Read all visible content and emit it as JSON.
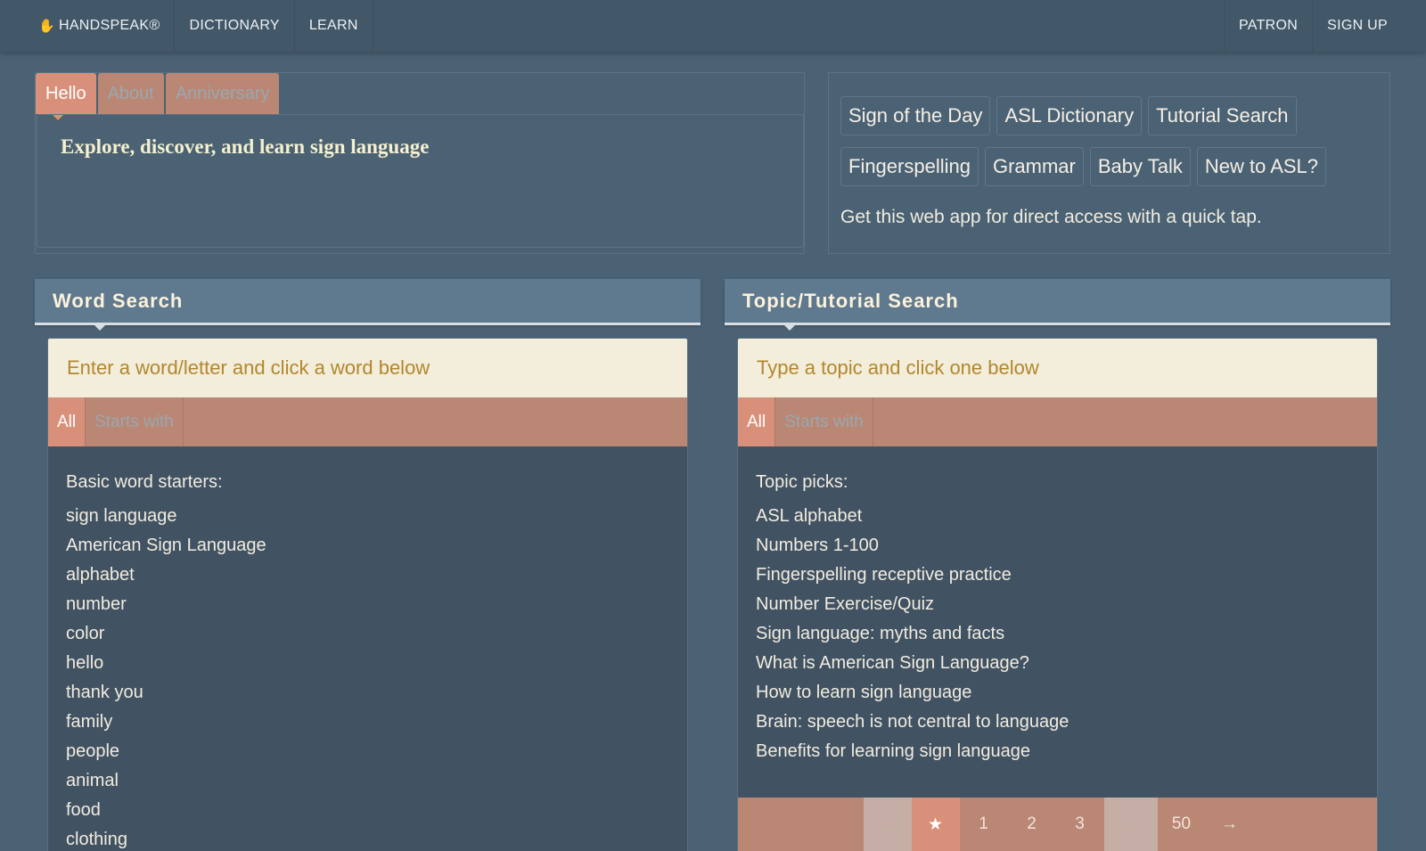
{
  "nav": {
    "brand": "HANDSPEAK®",
    "brand_icon": "hand-icon",
    "left_items": [
      "DICTIONARY",
      "LEARN"
    ],
    "right_items": [
      "PATRON",
      "SIGN UP"
    ]
  },
  "hello": {
    "tabs": [
      "Hello",
      "About",
      "Anniversary"
    ],
    "active_tab": "Hello",
    "text": "Explore, discover, and learn sign language"
  },
  "quick_links": {
    "row1": [
      "Sign of the Day",
      "ASL Dictionary",
      "Tutorial Search"
    ],
    "row2": [
      "Fingerspelling",
      "Grammar",
      "Baby Talk",
      "New to ASL?"
    ],
    "note_link": "Get this web app",
    "note_rest": " for direct access with a quick tap."
  },
  "word_search": {
    "title": "Word Search",
    "placeholder": "Enter a word/letter and click a word below",
    "filters": [
      "All",
      "Starts with"
    ],
    "heading": "Basic word starters:",
    "items": [
      "sign language",
      "American Sign Language",
      "alphabet",
      "number",
      "color",
      "hello",
      "thank you",
      "family",
      "people",
      "animal",
      "food",
      "clothing"
    ]
  },
  "topic_search": {
    "title": "Topic/Tutorial Search",
    "placeholder": "Type a topic and click one below",
    "filters": [
      "All",
      "Starts with"
    ],
    "heading": "Topic picks:",
    "items": [
      "ASL alphabet",
      "Numbers 1-100",
      "Fingerspelling receptive practice",
      "Number Exercise/Quiz",
      "Sign language: myths and facts",
      "What is American Sign Language?",
      "How to learn sign language",
      "Brain: speech is not central to language",
      "Benefits for learning sign language"
    ],
    "pager": {
      "prev": "←",
      "star": "★",
      "pages": [
        "1",
        "2",
        "3"
      ],
      "ellipsis": "...",
      "last": "50",
      "next": "→"
    }
  },
  "colors": {
    "background": "#4a6274",
    "accent": "#d9907a",
    "accent_muted": "#b98774",
    "input_bg": "#f3eddb",
    "headline": "#f5f0cf"
  }
}
